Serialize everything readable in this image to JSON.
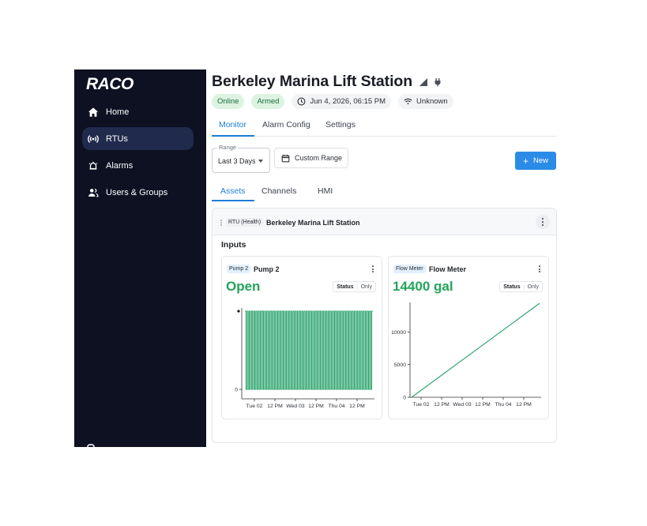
{
  "brand": {
    "logo_text": "RACO"
  },
  "sidebar": {
    "items": [
      {
        "label": "Home",
        "icon": "home-icon",
        "active": false
      },
      {
        "label": "RTUs",
        "icon": "rtu-signal-icon",
        "active": true
      },
      {
        "label": "Alarms",
        "icon": "alarm-icon",
        "active": false
      },
      {
        "label": "Users & Groups",
        "icon": "users-icon",
        "active": false
      }
    ]
  },
  "header": {
    "title": "Berkeley Marina Lift Station",
    "icons": [
      "signal-strength-icon",
      "power-plug-icon"
    ],
    "badges": {
      "online": "Online",
      "armed": "Armed",
      "timestamp": "Jun 4, 2026, 06:15 PM",
      "connection": "Unknown"
    }
  },
  "tabs": [
    "Monitor",
    "Alarm Config",
    "Settings"
  ],
  "active_tab": "Monitor",
  "controls": {
    "range_label": "Range",
    "range_value": "Last 3 Days",
    "custom_range": "Custom Range",
    "new_button": "New"
  },
  "subtabs": [
    "Assets",
    "Channels",
    "HMI"
  ],
  "active_subtab": "Assets",
  "asset_panel": {
    "tag": "RTU (Health)",
    "name": "Berkeley Marina Lift Station",
    "section_label": "Inputs"
  },
  "cards": [
    {
      "tag": "Pump 2",
      "name": "Pump 2",
      "value": "Open",
      "status_label": "Status",
      "only_label": "Only"
    },
    {
      "tag": "Flow Meter",
      "name": "Flow Meter",
      "value": "14400 gal",
      "status_label": "Status",
      "only_label": "Only"
    }
  ],
  "colors": {
    "sidebar_bg": "#0d1122",
    "sidebar_active": "#202a4c",
    "accent": "#1d7ed6",
    "button_blue": "#2b8ce8",
    "badge_green_bg": "#dcf3e2",
    "value_green": "#23a45a",
    "chart_line": "#2aa36b"
  },
  "chart_data": [
    {
      "type": "line",
      "series": [
        {
          "values_description_free": true,
          "x_start": "Mon 01 6 PM",
          "points_per_day": 21,
          "values": [
            1,
            0,
            1,
            0,
            1,
            0,
            1,
            0,
            1,
            0,
            1,
            0,
            1,
            0,
            1,
            0,
            1,
            0,
            1,
            0,
            1,
            0,
            1,
            0,
            1,
            0,
            1,
            0,
            1,
            0,
            1,
            0,
            1,
            0,
            1,
            0,
            1,
            0,
            1,
            0,
            1,
            0,
            1,
            0,
            1,
            0,
            1,
            0,
            1,
            0,
            1,
            0,
            1,
            0,
            1,
            0,
            1,
            0,
            1,
            0,
            1,
            0,
            1,
            0,
            1,
            0,
            1,
            0,
            1,
            0,
            1,
            0,
            1,
            0,
            1,
            0,
            1,
            0,
            1,
            0,
            1,
            0,
            1,
            0,
            1,
            0,
            1,
            0,
            1,
            0,
            1,
            0,
            1,
            0,
            1,
            0,
            1,
            0,
            1,
            0,
            1,
            0,
            1,
            0,
            1,
            0,
            1,
            0,
            1,
            0,
            1,
            0,
            1,
            0,
            1,
            0,
            1
          ]
        }
      ],
      "x_tick_labels": [
        "Tue 02",
        "12 PM",
        "Wed 03",
        "12 PM",
        "Thu 04",
        "12 PM"
      ],
      "y_tick_labels": [
        "0"
      ],
      "ylim": [
        0,
        1
      ]
    },
    {
      "type": "line",
      "series": [
        {
          "x": [
            "Mon 01 6 PM",
            "Thu 04 6 PM"
          ],
          "values": [
            0,
            14400
          ]
        }
      ],
      "x_tick_labels": [
        "Tue 02",
        "12 PM",
        "Wed 03",
        "12 PM",
        "Thu 04",
        "12 PM"
      ],
      "y_ticks": [
        0,
        5000,
        10000
      ],
      "y_tick_labels": [
        "0",
        "5000",
        "10000"
      ],
      "ylim": [
        0,
        14400
      ]
    }
  ]
}
